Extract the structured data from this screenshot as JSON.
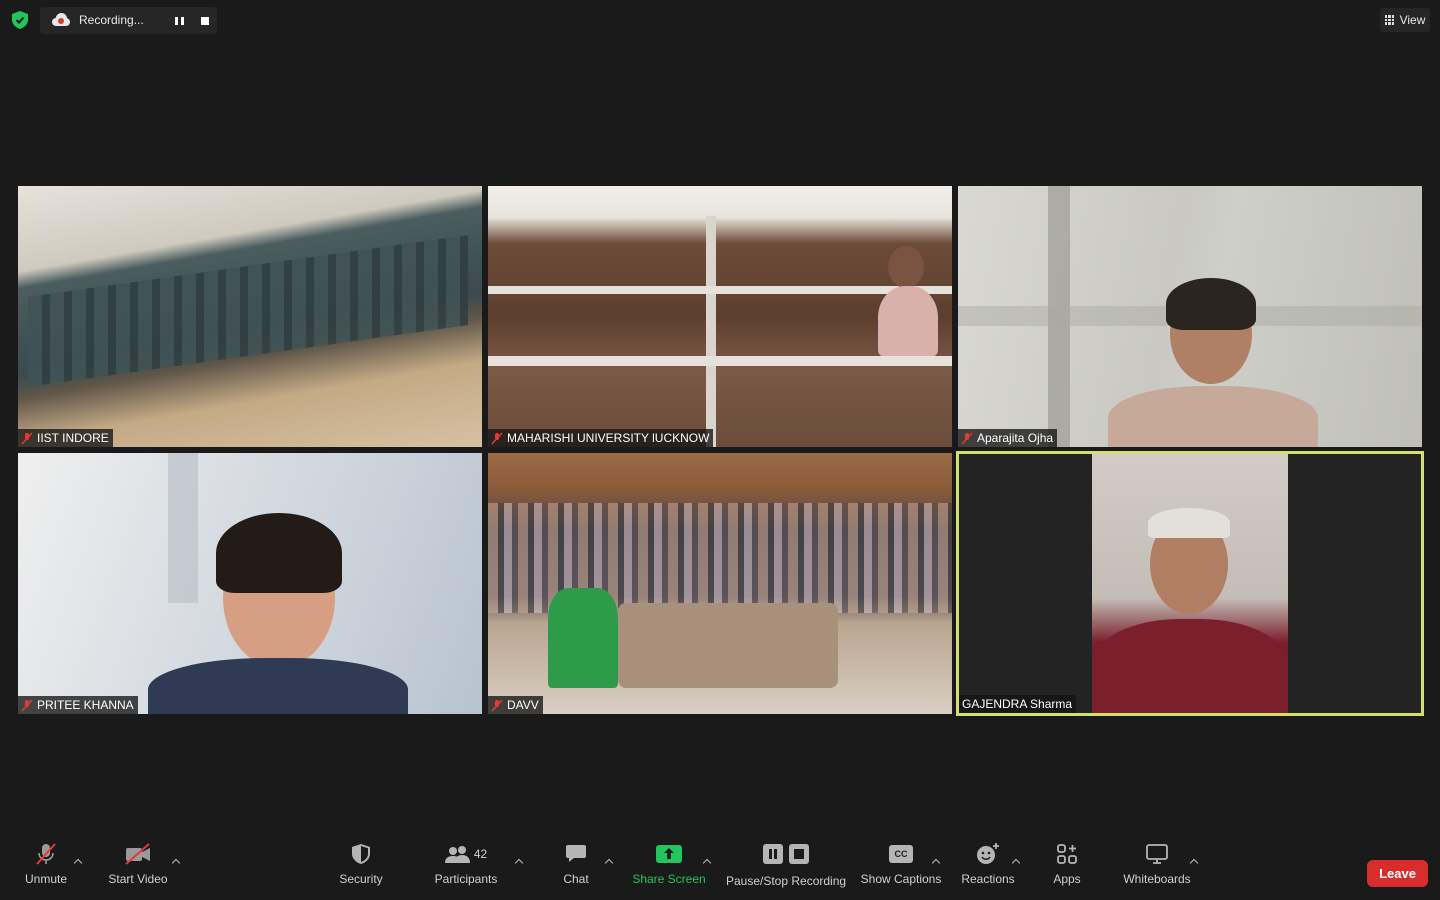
{
  "recording": {
    "status": "Recording..."
  },
  "view": {
    "label": "View"
  },
  "tiles": [
    {
      "name": "IIST INDORE",
      "muted": true
    },
    {
      "name": "MAHARISHI UNIVERSITY lUCKNOW",
      "muted": true
    },
    {
      "name": "Aparajita Ojha",
      "muted": true
    },
    {
      "name": "PRITEE KHANNA",
      "muted": true
    },
    {
      "name": "DAVV",
      "muted": true
    },
    {
      "name": "GAJENDRA Sharma",
      "muted": false,
      "active_speaker": true
    }
  ],
  "toolbar": {
    "unmute": "Unmute",
    "start_video": "Start Video",
    "security": "Security",
    "participants": "Participants",
    "participants_count": "42",
    "chat": "Chat",
    "share_screen": "Share Screen",
    "pause_stop_recording": "Pause/Stop Recording",
    "show_captions": "Show Captions",
    "captions_icon_text": "CC",
    "reactions": "Reactions",
    "apps": "Apps",
    "whiteboards": "Whiteboards",
    "leave": "Leave"
  },
  "colors": {
    "background": "#1a1a1a",
    "active_speaker_border": "#d3e06e",
    "share_green": "#22c55e",
    "leave_red": "#d92d2d",
    "muted_red": "#e53935",
    "shield_green": "#22c55e"
  }
}
